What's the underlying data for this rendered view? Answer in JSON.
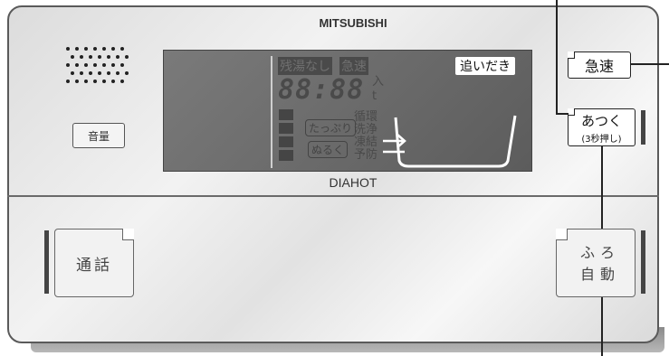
{
  "brand": "MITSUBISHI",
  "sub_brand": "DIAHOT",
  "volume_label": "音量",
  "display": {
    "zan_yu_nashi": "残湯なし",
    "kyusoku": "急速",
    "oidaki": "追いだき",
    "digits": "88:88",
    "iri": "入",
    "t": "t",
    "labels": [
      "循環",
      "洗浄",
      "凍結",
      "予防"
    ],
    "tappuri": "たっぷり",
    "nuruku": "ぬるく"
  },
  "buttons": {
    "kyusoku": "急速",
    "atsuku": "あつく",
    "atsuku_sub": "(3秒押し)",
    "tsuuwa": "通話",
    "furo_line1": "ふろ",
    "furo_line2": "自動"
  }
}
